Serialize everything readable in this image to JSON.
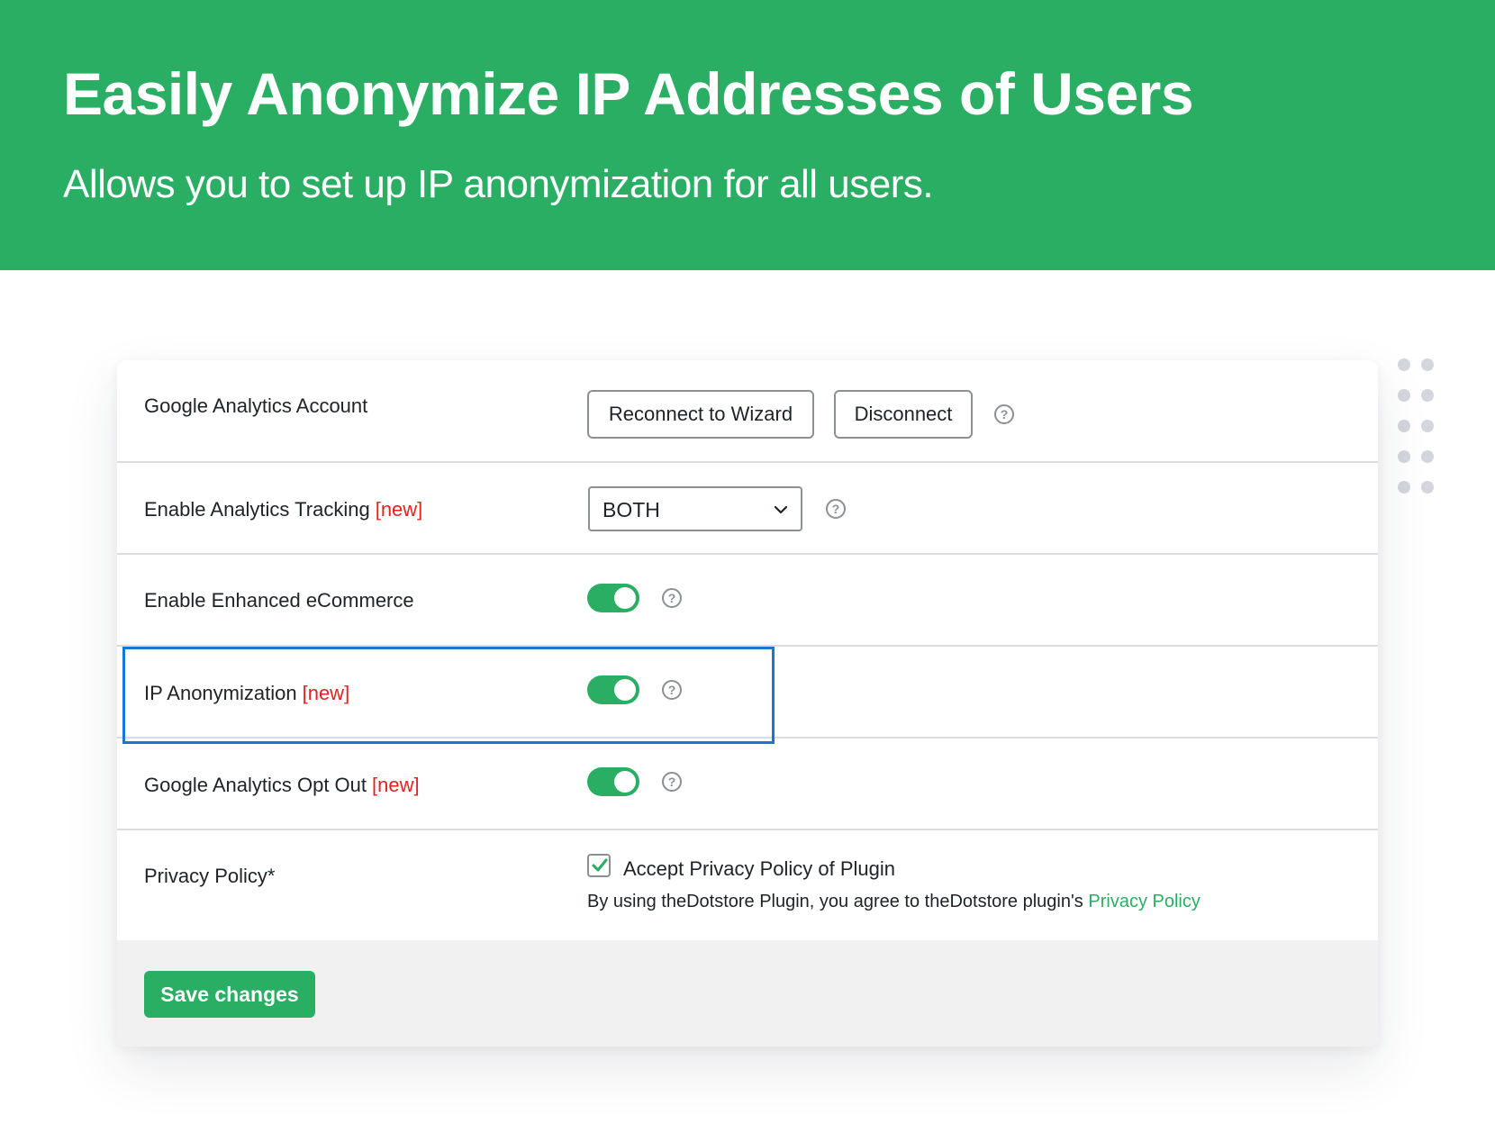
{
  "hero": {
    "title": "Easily Anonymize IP Addresses of Users",
    "subtitle": "Allows you to set up IP anonymization for all users."
  },
  "settings": {
    "ga_account": {
      "label": "Google Analytics Account",
      "reconnect_label": "Reconnect to Wizard",
      "disconnect_label": "Disconnect"
    },
    "tracking": {
      "label": "Enable Analytics Tracking",
      "new_tag": "[new]",
      "selected": "BOTH"
    },
    "enhanced_ecommerce": {
      "label": "Enable Enhanced eCommerce",
      "enabled": true
    },
    "ip_anonymization": {
      "label": "IP Anonymization",
      "new_tag": "[new]",
      "enabled": true
    },
    "opt_out": {
      "label": "Google Analytics Opt Out",
      "new_tag": "[new]",
      "enabled": true
    },
    "privacy_policy": {
      "label": "Privacy Policy*",
      "checkbox_label": "Accept Privacy Policy of Plugin",
      "checked": true,
      "note": "By using theDotstore Plugin, you agree to theDotstore plugin's",
      "link_text": "Privacy Policy"
    }
  },
  "help_glyph": "?",
  "footer": {
    "save_label": "Save changes"
  },
  "icons": {
    "help": "help-circle-icon",
    "select_arrow": "chevron-down-icon",
    "check": "checkmark-icon"
  },
  "colors": {
    "brand_green": "#2aae63",
    "new_tag_red": "#e32222",
    "highlight_blue": "#1976d2"
  }
}
